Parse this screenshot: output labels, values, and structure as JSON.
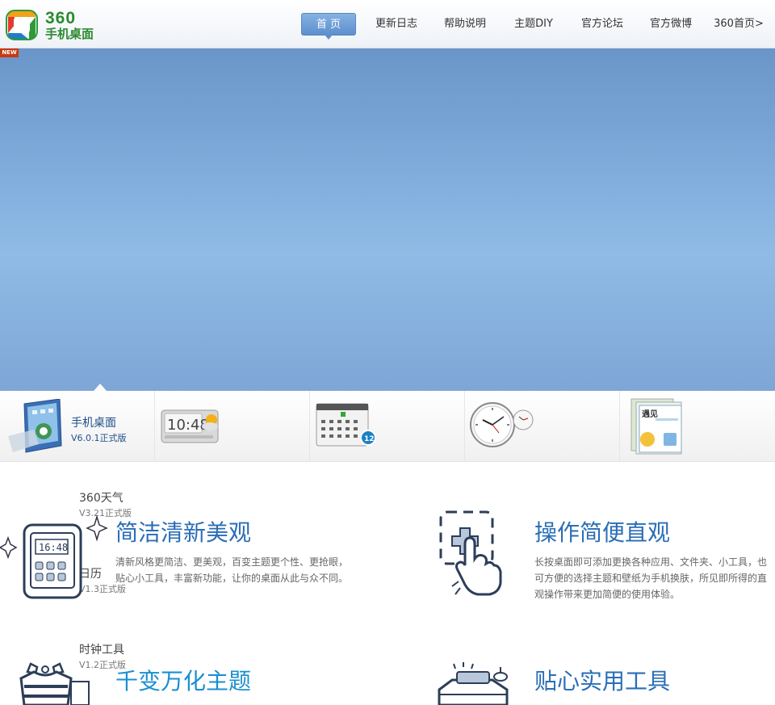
{
  "header": {
    "logo": {
      "number": "360",
      "subtitle": "手机桌面"
    },
    "nav": [
      {
        "label": "首 页",
        "active": true
      },
      {
        "label": "更新日志"
      },
      {
        "label": "帮助说明"
      },
      {
        "label": "主题DIY"
      },
      {
        "label": "官方论坛"
      },
      {
        "label": "官方微博"
      },
      {
        "label": "360首页>"
      }
    ]
  },
  "badge": {
    "new": "NEW"
  },
  "products": [
    {
      "name": "手机桌面",
      "version": "V6.0.1正式版"
    },
    {
      "name": "360天气",
      "version": "V3.21正式版"
    },
    {
      "name": "日历",
      "version": "V1.3正式版"
    },
    {
      "name": "时钟工具",
      "version": "V1.2正式版"
    }
  ],
  "clock_widget": {
    "time": "10:48"
  },
  "phone_icon": {
    "time": "16:48"
  },
  "calendar_widget": {
    "date": "12"
  },
  "wallpaper_thumb": {
    "text": "遇见"
  },
  "features": [
    {
      "title": "简洁清新美观",
      "description": "清新风格更简洁、更美观，百变主题更个性、更抢眼，贴心小工具，丰富新功能，让你的桌面从此与众不同。",
      "color": "#2a6eb6"
    },
    {
      "title": "操作简便直观",
      "description": "长按桌面即可添加更换各种应用、文件夹、小工具，也可方便的选择主题和壁纸为手机换肤，所见即所得的直观操作带来更加简便的使用体验。",
      "color": "#2a6eb6"
    },
    {
      "title": "千变万化主题",
      "color": "#1a8fd0"
    },
    {
      "title": "贴心实用工具",
      "color": "#2a6eb6"
    }
  ],
  "colors": {
    "accent": "#5d8fcc",
    "brand_green": "#2c8a2f",
    "banner": "#85b2e0"
  }
}
